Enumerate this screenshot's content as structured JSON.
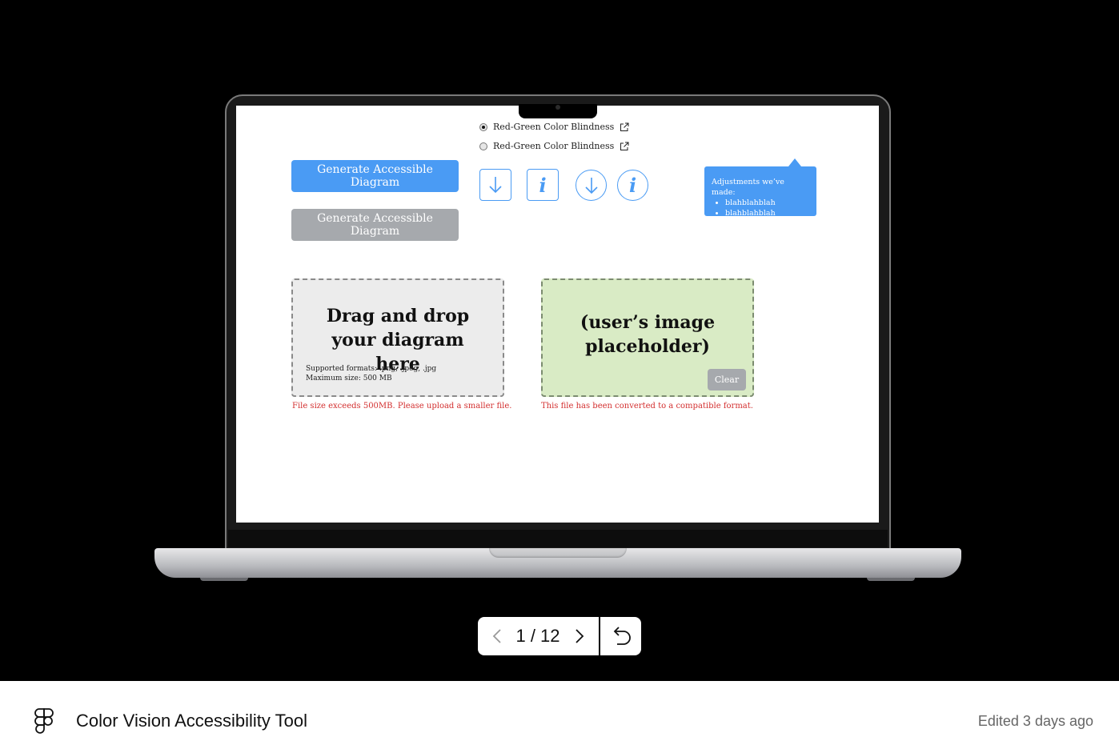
{
  "prototype": {
    "radio_options": [
      {
        "label": "Red-Green Color Blindness",
        "selected": true
      },
      {
        "label": "Red-Green Color Blindness",
        "selected": false
      }
    ],
    "generate_button_active": "Generate Accessible Diagram",
    "generate_button_disabled": "Generate Accessible Diagram",
    "icons": [
      "download-square-icon",
      "info-square-icon",
      "download-circle-icon",
      "info-circle-icon"
    ],
    "icon_info_letter": "i",
    "tooltip": {
      "title": "Adjustments we’ve made:",
      "items": [
        "blahblahblah",
        "blahblahblah"
      ]
    },
    "upload": {
      "title": "Drag and drop your diagram here",
      "formats": "Supported formats: .png, .jpeg, .jpg",
      "max_size": "Maximum size: 500 MB",
      "error": "File size exceeds 500MB. Please upload a smaller file."
    },
    "preview": {
      "title": "(user’s image placeholder)",
      "clear_label": "Clear",
      "notice": "This file has been converted to a compatible format."
    },
    "colors": {
      "accent": "#4a9bf4",
      "disabled": "#a6a9ad",
      "error": "#d32f2f",
      "preview_bg": "#d9ebc5"
    }
  },
  "pager": {
    "label": "1 / 12"
  },
  "footer": {
    "file_title": "Color Vision Accessibility Tool",
    "edited": "Edited 3 days ago"
  }
}
